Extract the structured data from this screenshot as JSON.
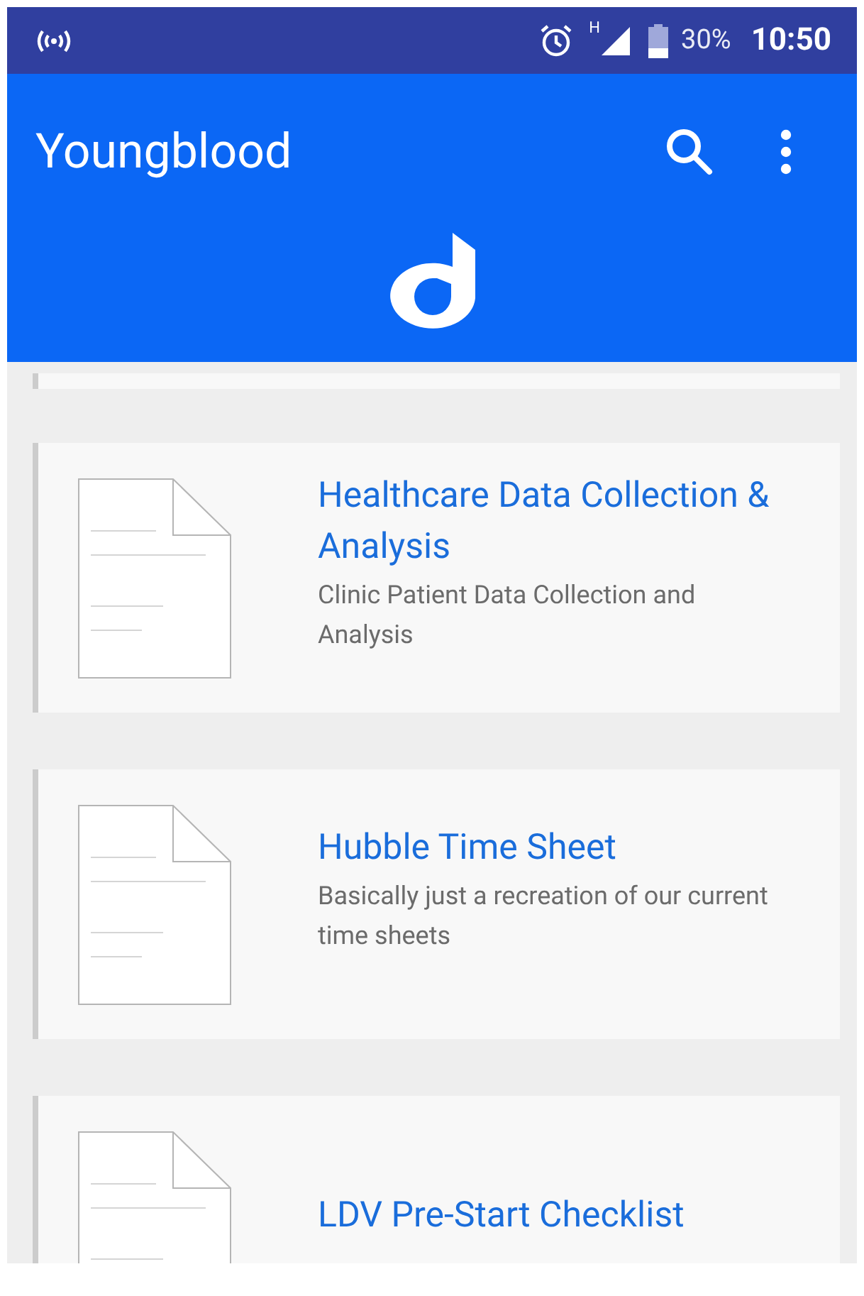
{
  "status_bar": {
    "network_type": "H",
    "battery": "30%",
    "time": "10:50"
  },
  "app_bar": {
    "title": "Youngblood"
  },
  "forms": [
    {
      "title": "Healthcare Data Collection & Analysis",
      "description": "Clinic Patient Data Collection and Analysis"
    },
    {
      "title": "Hubble Time Sheet",
      "description": "Basically just a recreation of our current time sheets"
    },
    {
      "title": "LDV Pre-Start Checklist"
    }
  ]
}
